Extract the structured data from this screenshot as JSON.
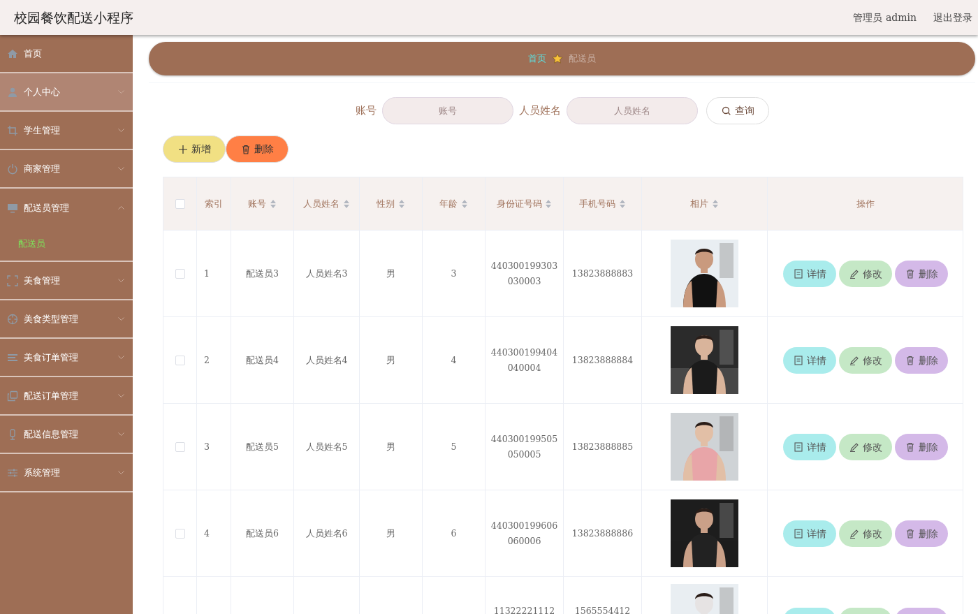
{
  "header": {
    "title": "校园餐饮配送小程序",
    "user": "管理员 admin",
    "logout": "退出登录"
  },
  "sidebar": {
    "items": [
      {
        "label": "首页",
        "kind": "link",
        "hovered": false
      },
      {
        "label": "个人中心",
        "kind": "group",
        "expanded": false,
        "hovered": true
      },
      {
        "label": "学生管理",
        "kind": "group",
        "expanded": false,
        "hovered": false
      },
      {
        "label": "商家管理",
        "kind": "group",
        "expanded": false,
        "hovered": false
      },
      {
        "label": "配送员管理",
        "kind": "group",
        "expanded": true,
        "hovered": false,
        "children": [
          {
            "label": "配送员",
            "selected": true
          }
        ]
      },
      {
        "label": "美食管理",
        "kind": "group",
        "expanded": false,
        "hovered": false
      },
      {
        "label": "美食类型管理",
        "kind": "group",
        "expanded": false,
        "hovered": false
      },
      {
        "label": "美食订单管理",
        "kind": "group",
        "expanded": false,
        "hovered": false
      },
      {
        "label": "配送订单管理",
        "kind": "group",
        "expanded": false,
        "hovered": false
      },
      {
        "label": "配送信息管理",
        "kind": "group",
        "expanded": false,
        "hovered": false
      },
      {
        "label": "系统管理",
        "kind": "group",
        "expanded": false,
        "hovered": false
      }
    ]
  },
  "breadcrumb": [
    {
      "label": "首页",
      "selected": true
    },
    {
      "label": "配送员",
      "selected": false
    }
  ],
  "search": {
    "fields": [
      {
        "label": "账号",
        "placeholder": "账号"
      },
      {
        "label": "人员姓名",
        "placeholder": "人员姓名"
      }
    ],
    "button": "查询"
  },
  "actions": [
    {
      "label": "新增",
      "kind": "add"
    },
    {
      "label": "删除",
      "kind": "delete"
    }
  ],
  "table": {
    "select_all": {
      "checked": false
    },
    "columns": [
      {
        "label": "索引",
        "sortable": false
      },
      {
        "label": "账号",
        "sortable": true
      },
      {
        "label": "人员姓名",
        "sortable": true
      },
      {
        "label": "性别",
        "sortable": true
      },
      {
        "label": "年龄",
        "sortable": true
      },
      {
        "label": "身份证号码",
        "sortable": true
      },
      {
        "label": "手机号码",
        "sortable": true
      },
      {
        "label": "相片",
        "sortable": true
      },
      {
        "label": "操作",
        "sortable": false
      }
    ],
    "rows": [
      {
        "checked": false,
        "cells": [
          "1",
          "配送员3",
          "人员姓名3",
          "男",
          "3",
          "440300199303030003",
          "13823888883"
        ],
        "actions": [
          {
            "label": "详情",
            "kind": "detail"
          },
          {
            "label": "修改",
            "kind": "edit"
          },
          {
            "label": "删除",
            "kind": "delete"
          }
        ]
      },
      {
        "checked": false,
        "cells": [
          "2",
          "配送员4",
          "人员姓名4",
          "男",
          "4",
          "440300199404040004",
          "13823888884"
        ],
        "actions": [
          {
            "label": "详情",
            "kind": "detail"
          },
          {
            "label": "修改",
            "kind": "edit"
          },
          {
            "label": "删除",
            "kind": "delete"
          }
        ]
      },
      {
        "checked": false,
        "cells": [
          "3",
          "配送员5",
          "人员姓名5",
          "男",
          "5",
          "440300199505050005",
          "13823888885"
        ],
        "actions": [
          {
            "label": "详情",
            "kind": "detail"
          },
          {
            "label": "修改",
            "kind": "edit"
          },
          {
            "label": "删除",
            "kind": "delete"
          }
        ]
      },
      {
        "checked": false,
        "cells": [
          "4",
          "配送员6",
          "人员姓名6",
          "男",
          "6",
          "440300199606060006",
          "13823888886"
        ],
        "actions": [
          {
            "label": "详情",
            "kind": "detail"
          },
          {
            "label": "修改",
            "kind": "edit"
          },
          {
            "label": "删除",
            "kind": "delete"
          }
        ]
      },
      {
        "cells": [
          "",
          "",
          "",
          "",
          "",
          "11322221112",
          "1565554412"
        ]
      }
    ]
  }
}
